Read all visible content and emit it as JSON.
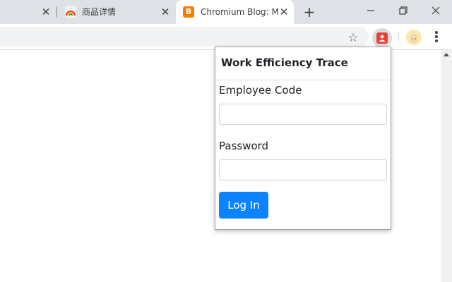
{
  "tabs": [
    {
      "title": "",
      "favicon": "tab-favicon"
    },
    {
      "title": "商品详情",
      "favicon": "rainbow-icon"
    },
    {
      "title": "Chromium Blog: Mo",
      "favicon": "blogger-icon",
      "active": true
    }
  ],
  "toolbar": {
    "bookmark_icon": "star-icon",
    "extension_icon": "extension-icon",
    "profile_icon": "avatar",
    "menu_icon": "kebab-menu-icon"
  },
  "popup": {
    "title": "Work Efficiency Trace",
    "employee_code_label": "Employee Code",
    "employee_code_value": "",
    "password_label": "Password",
    "password_value": "",
    "login_label": "Log In"
  },
  "colors": {
    "login_button": "#0d84ff",
    "blogger_favicon": "#f57d00",
    "extension_icon": "#ea4335",
    "tabstrip": "#dee1e6"
  }
}
